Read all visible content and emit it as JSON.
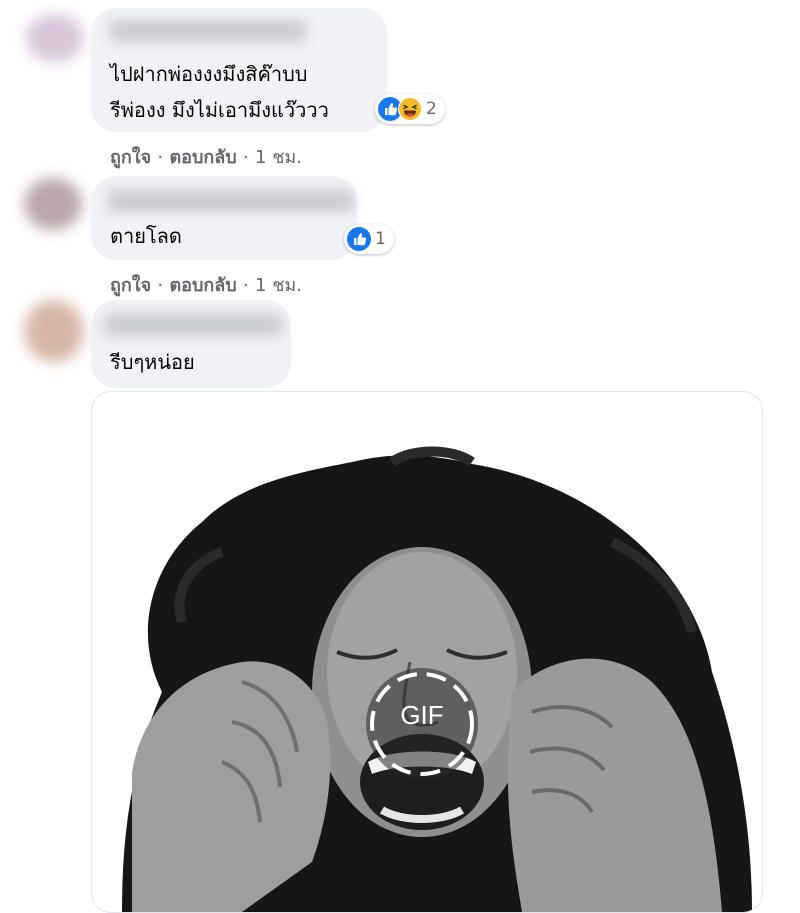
{
  "comments": [
    {
      "text_lines": [
        "ไปฝากพ่องงงมึงสิค๊าบบ",
        "รีพ่องง มึงไม่เอามึงแว๊ววว"
      ],
      "reaction_icons": [
        "like-icon",
        "haha-icon"
      ],
      "reaction_count": "2",
      "actions": {
        "like": "ถูกใจ",
        "reply": "ตอบกลับ",
        "time": "1 ชม.",
        "sep": "·"
      }
    },
    {
      "text_lines": [
        "ตายโลด"
      ],
      "reaction_icons": [
        "like-icon"
      ],
      "reaction_count": "1",
      "actions": {
        "like": "ถูกใจ",
        "reply": "ตอบกลับ",
        "time": "1 ชม.",
        "sep": "·"
      }
    },
    {
      "text_lines": [
        "รีบๆหน่อย"
      ],
      "gif_label": "GIF"
    }
  ],
  "colors": {
    "bubble": "#f0f2f5",
    "meta_text": "#65676b",
    "like_blue": "#1877f2",
    "haha_yellow": "#f7b928"
  }
}
